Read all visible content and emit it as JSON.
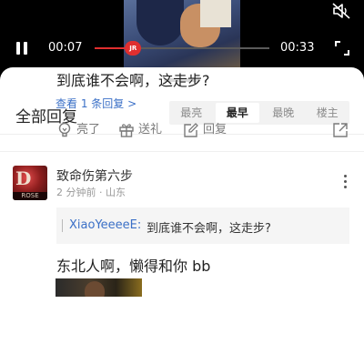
{
  "player": {
    "current_time": "00:07",
    "duration": "00:33",
    "progress": 0.22,
    "thumb_label": "JR",
    "accent_color": "#e02f2f",
    "mute_icon": "speaker-muted-icon",
    "fullscreen_icon": "fullscreen-icon",
    "pause_icon": "pause-icon"
  },
  "comments_panel": {
    "title": "全部回复",
    "sort_tabs": [
      {
        "label": "最亮",
        "active": false
      },
      {
        "label": "最早",
        "active": true
      },
      {
        "label": "最晚",
        "active": false
      },
      {
        "label": "楼主",
        "active": false
      }
    ]
  },
  "comment1": {
    "text": "到底谁不会啊，这走步?",
    "view_replies": "查看 1 条回复 >",
    "actions": {
      "light": "亮了",
      "gift": "送礼",
      "reply": "回复"
    }
  },
  "comment2": {
    "avatar_text": "ROSE",
    "username": "致命伤第六步",
    "meta": "2 分钟前 · 山东",
    "quote_user": "XiaoYeeeeE:",
    "quote_text": "到底谁不会啊，这走步?",
    "text": "东北人啊，懒得和你 bb"
  },
  "colors": {
    "link": "#3b70c7",
    "muted_text": "#7a7a7a"
  }
}
